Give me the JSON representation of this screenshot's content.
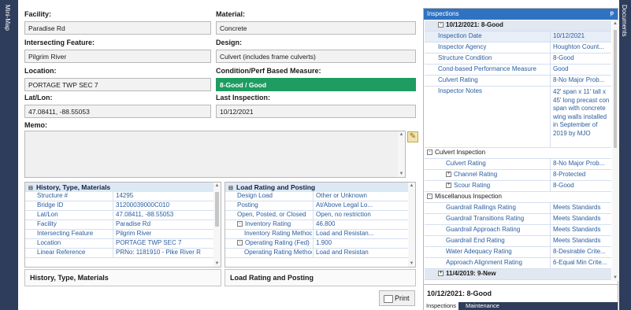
{
  "side": {
    "left_label": "Mini-Map",
    "right_label": "Documents"
  },
  "form": {
    "facility": {
      "label": "Facility:",
      "value": "Paradise Rd"
    },
    "material": {
      "label": "Material:",
      "value": "Concrete"
    },
    "intersecting": {
      "label": "Intersecting Feature:",
      "value": "Pilgrim River"
    },
    "design": {
      "label": "Design:",
      "value": "Culvert (includes frame culverts)"
    },
    "location": {
      "label": "Location:",
      "value": "PORTAGE TWP SEC 7"
    },
    "condition": {
      "label": "Condition/Perf Based Measure:",
      "value": "8-Good / Good"
    },
    "latlon": {
      "label": "Lat/Lon:",
      "value": "47.08411, -88.55053"
    },
    "last_inspection": {
      "label": "Last Inspection:",
      "value": "10/12/2021"
    },
    "memo": {
      "label": "Memo:",
      "value": ""
    }
  },
  "history": {
    "title": "History, Type, Materials",
    "rows": [
      {
        "k": "Structure #",
        "v": "14295"
      },
      {
        "k": "Bridge ID",
        "v": "31200039000C010"
      },
      {
        "k": "Lat/Lon",
        "v": "47.08411, -88.55053"
      },
      {
        "k": "Facility",
        "v": "Paradise Rd"
      },
      {
        "k": "Intersecting Feature",
        "v": "Pilgrim River"
      },
      {
        "k": "Location",
        "v": "PORTAGE TWP SEC 7"
      },
      {
        "k": "Linear Reference",
        "v": "PRNo: 1181910 - Pike River R"
      }
    ],
    "footer": "History, Type, Materials"
  },
  "load": {
    "title": "Load Rating and Posting",
    "rows": [
      {
        "k": "Design Load",
        "v": "Other or Unknown"
      },
      {
        "k": "Posting",
        "v": "At/Above Legal Lo..."
      },
      {
        "k": "Open, Posted, or Closed",
        "v": "Open, no restriction"
      },
      {
        "k": "Inventory Rating",
        "v": "46.800",
        "tog": "⊟"
      },
      {
        "k": "Inventory Rating Method",
        "v": "Load and Resistan...",
        "sub": true
      },
      {
        "k": "Operating Rating (Fed)",
        "v": "1.900",
        "tog": "⊟"
      },
      {
        "k": "Operating Rating Method (Fed)",
        "v": "Load and Resistan",
        "sub": true
      }
    ],
    "footer": "Load Rating and Posting"
  },
  "print_label": "Print",
  "inspections": {
    "panel_title": "Inspections",
    "pin": "ᵽ",
    "header": "10/12/2021: 8-Good",
    "rows": [
      {
        "k": "Inspection Date",
        "v": "10/12/2021"
      },
      {
        "k": "Inspector Agency",
        "v": "Houghton Count..."
      },
      {
        "k": "Structure Condition",
        "v": "8-Good"
      },
      {
        "k": "Cond-based Performance Measure",
        "v": "Good"
      },
      {
        "k": "Culvert Rating",
        "v": "8-No Major Prob..."
      }
    ],
    "notes_label": "Inspector Notes",
    "notes": "42' span x 11' tall x 45' long precast con span with concrete wing walls installed in September of 2019 by MJO",
    "culvert_group": "Culvert Inspection",
    "culvert_rows": [
      {
        "k": "Culvert Rating",
        "v": "8-No Major Prob..."
      },
      {
        "k": "Channel Rating",
        "v": "8-Protected",
        "tog": "⊞"
      },
      {
        "k": "Scour Rating",
        "v": "8-Good",
        "tog": "⊞"
      }
    ],
    "misc_group": "Miscellanous Inspection",
    "misc_rows": [
      {
        "k": "Guardrail Railings Rating",
        "v": "Meets Standards"
      },
      {
        "k": "Guardrail Transitions Rating",
        "v": "Meets Standards"
      },
      {
        "k": "Guardrail Approach Rating",
        "v": "Meets Standards"
      },
      {
        "k": "Guardrail End Rating",
        "v": "Meets Standards"
      },
      {
        "k": "Water Adequacy Rating",
        "v": "8-Desirable Crite..."
      },
      {
        "k": "Approach Alignment Rating",
        "v": "6-Equal Min Crite..."
      }
    ],
    "next_header": "11/4/2019: 9-New",
    "footer": "10/12/2021: 8-Good",
    "tabs": [
      "Inspections",
      "Maintenance"
    ]
  },
  "colors": {
    "accent": "#2f72c2",
    "condition_green": "#1f9c61",
    "sidebar": "#2e3d5c"
  }
}
